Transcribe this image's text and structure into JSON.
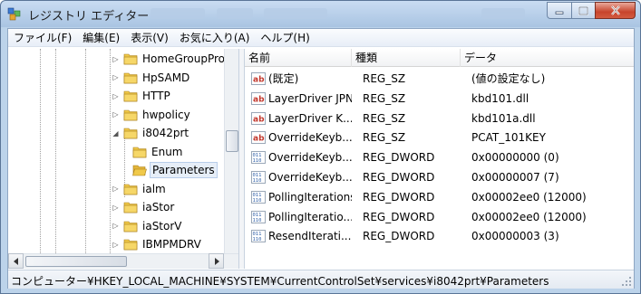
{
  "window": {
    "title": "レジストリ エディター",
    "buttons": {
      "minimize": "minimize",
      "maximize": "maximize",
      "close": "close"
    }
  },
  "menu": [
    {
      "label": "ファイル(F)"
    },
    {
      "label": "編集(E)"
    },
    {
      "label": "表示(V)"
    },
    {
      "label": "お気に入り(A)"
    },
    {
      "label": "ヘルプ(H)"
    }
  ],
  "tree": {
    "items": [
      {
        "label": "HomeGroupProv",
        "expander": "▷",
        "level": 0,
        "selected": false
      },
      {
        "label": "HpSAMD",
        "expander": "▷",
        "level": 0,
        "selected": false
      },
      {
        "label": "HTTP",
        "expander": "▷",
        "level": 0,
        "selected": false
      },
      {
        "label": "hwpolicy",
        "expander": "▷",
        "level": 0,
        "selected": false
      },
      {
        "label": "i8042prt",
        "expander": "◢",
        "level": 0,
        "selected": false
      },
      {
        "label": "Enum",
        "expander": "",
        "level": 1,
        "selected": false
      },
      {
        "label": "Parameters",
        "expander": "",
        "level": 1,
        "selected": true
      },
      {
        "label": "ialm",
        "expander": "▷",
        "level": 0,
        "selected": false
      },
      {
        "label": "iaStor",
        "expander": "▷",
        "level": 0,
        "selected": false
      },
      {
        "label": "iaStorV",
        "expander": "▷",
        "level": 0,
        "selected": false
      },
      {
        "label": "IBMPMDRV",
        "expander": "▷",
        "level": 0,
        "selected": false
      }
    ]
  },
  "list": {
    "columns": {
      "name": "名前",
      "type": "種類",
      "data": "データ"
    },
    "rows": [
      {
        "icon": "ab",
        "name": "(既定)",
        "type": "REG_SZ",
        "data": "(値の設定なし)"
      },
      {
        "icon": "ab",
        "name": "LayerDriver JPN",
        "type": "REG_SZ",
        "data": "kbd101.dll"
      },
      {
        "icon": "ab",
        "name": "LayerDriver K...",
        "type": "REG_SZ",
        "data": "kbd101a.dll"
      },
      {
        "icon": "ab",
        "name": "OverrideKeyb...",
        "type": "REG_SZ",
        "data": "PCAT_101KEY"
      },
      {
        "icon": "bin",
        "name": "OverrideKeyb...",
        "type": "REG_DWORD",
        "data": "0x00000000 (0)"
      },
      {
        "icon": "bin",
        "name": "OverrideKeyb...",
        "type": "REG_DWORD",
        "data": "0x00000007 (7)"
      },
      {
        "icon": "bin",
        "name": "PollingIterations",
        "type": "REG_DWORD",
        "data": "0x00002ee0 (12000)"
      },
      {
        "icon": "bin",
        "name": "PollingIteratio...",
        "type": "REG_DWORD",
        "data": "0x00002ee0 (12000)"
      },
      {
        "icon": "bin",
        "name": "ResendIterati...",
        "type": "REG_DWORD",
        "data": "0x00000003 (3)"
      }
    ]
  },
  "status": {
    "path": "コンピューター¥HKEY_LOCAL_MACHINE¥SYSTEM¥CurrentControlSet¥services¥i8042prt¥Parameters"
  },
  "colors": {
    "ab_icon": "#c2372c",
    "bin_icon": "#2e5fa8",
    "folder": "#f0c94a"
  }
}
